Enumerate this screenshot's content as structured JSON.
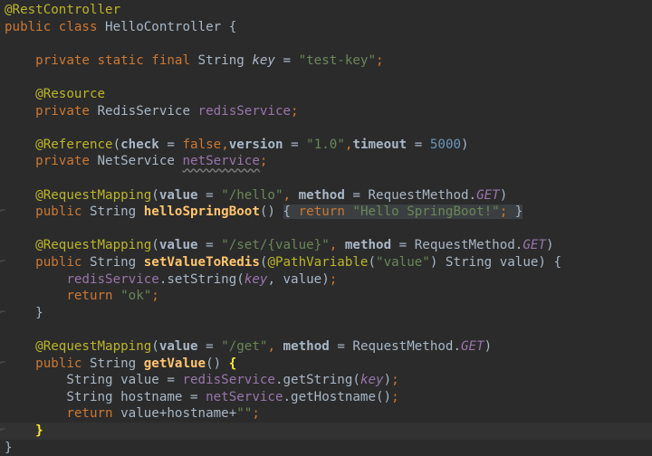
{
  "code_lines": [
    [
      {
        "t": "@RestController",
        "c": "an"
      }
    ],
    [
      {
        "t": "public ",
        "c": "kwp"
      },
      {
        "t": "class ",
        "c": "kwp"
      },
      {
        "t": "HelloController {",
        "c": "pl"
      }
    ],
    [],
    [
      {
        "t": "    private ",
        "c": "kwp"
      },
      {
        "t": "static ",
        "c": "kwp"
      },
      {
        "t": "final ",
        "c": "kwp"
      },
      {
        "t": "String ",
        "c": "pl"
      },
      {
        "t": "key",
        "c": "pl italic"
      },
      {
        "t": " = ",
        "c": "pl"
      },
      {
        "t": "\"test-key\"",
        "c": "str"
      },
      {
        "t": ";",
        "c": "kwp"
      }
    ],
    [],
    [
      {
        "t": "    @Resource",
        "c": "an"
      }
    ],
    [
      {
        "t": "    private ",
        "c": "kwp"
      },
      {
        "t": "RedisService ",
        "c": "pl"
      },
      {
        "t": "redisService",
        "c": "fld"
      },
      {
        "t": ";",
        "c": "kwp"
      }
    ],
    [],
    [
      {
        "t": "    @Reference",
        "c": "an"
      },
      {
        "t": "(",
        "c": "pl"
      },
      {
        "t": "check",
        "c": "pl bold"
      },
      {
        "t": " = ",
        "c": "pl"
      },
      {
        "t": "false",
        "c": "kwp"
      },
      {
        "t": ",",
        "c": "kwp"
      },
      {
        "t": "version",
        "c": "pl bold"
      },
      {
        "t": " = ",
        "c": "pl"
      },
      {
        "t": "\"1.0\"",
        "c": "str"
      },
      {
        "t": ",",
        "c": "kwp"
      },
      {
        "t": "timeout",
        "c": "pl bold"
      },
      {
        "t": " = ",
        "c": "pl"
      },
      {
        "t": "5000",
        "c": "num"
      },
      {
        "t": ")",
        "c": "pl"
      }
    ],
    [
      {
        "t": "    private ",
        "c": "kwp"
      },
      {
        "t": "NetService ",
        "c": "pl"
      },
      {
        "t": "netService",
        "c": "fld warn"
      },
      {
        "t": ";",
        "c": "kwp"
      }
    ],
    [],
    [
      {
        "t": "    @RequestMapping",
        "c": "an"
      },
      {
        "t": "(",
        "c": "pl"
      },
      {
        "t": "value",
        "c": "pl bold"
      },
      {
        "t": " = ",
        "c": "pl"
      },
      {
        "t": "\"/hello\"",
        "c": "str"
      },
      {
        "t": ", ",
        "c": "kwp"
      },
      {
        "t": "method",
        "c": "pl bold"
      },
      {
        "t": " = RequestMethod.",
        "c": "pl"
      },
      {
        "t": "GET",
        "c": "fld italic"
      },
      {
        "t": ")",
        "c": "pl"
      }
    ],
    [
      {
        "t": "    public ",
        "c": "kwp"
      },
      {
        "t": "String ",
        "c": "pl"
      },
      {
        "t": "helloSpringBoot",
        "c": "fn"
      },
      {
        "t": "() ",
        "c": "pl"
      },
      {
        "t": "{ ",
        "c": "pl folded"
      },
      {
        "t": "return ",
        "c": "kwp folded"
      },
      {
        "t": "\"Hello SpringBoot!\"",
        "c": "str folded"
      },
      {
        "t": "; ",
        "c": "kwp folded"
      },
      {
        "t": "}",
        "c": "pl folded"
      }
    ],
    [],
    [
      {
        "t": "    @RequestMapping",
        "c": "an"
      },
      {
        "t": "(",
        "c": "pl"
      },
      {
        "t": "value",
        "c": "pl bold"
      },
      {
        "t": " = ",
        "c": "pl"
      },
      {
        "t": "\"/set/{value}\"",
        "c": "str"
      },
      {
        "t": ", ",
        "c": "kwp"
      },
      {
        "t": "method",
        "c": "pl bold"
      },
      {
        "t": " = RequestMethod.",
        "c": "pl"
      },
      {
        "t": "GET",
        "c": "fld italic"
      },
      {
        "t": ")",
        "c": "pl"
      }
    ],
    [
      {
        "t": "    public ",
        "c": "kwp"
      },
      {
        "t": "String ",
        "c": "pl"
      },
      {
        "t": "setValueToRedis",
        "c": "fn"
      },
      {
        "t": "(",
        "c": "pl"
      },
      {
        "t": "@PathVariable",
        "c": "an"
      },
      {
        "t": "(",
        "c": "pl"
      },
      {
        "t": "\"value\"",
        "c": "str"
      },
      {
        "t": ") String value) {",
        "c": "pl"
      }
    ],
    [
      {
        "t": "        redisService",
        "c": "fld"
      },
      {
        "t": ".setString(",
        "c": "pl"
      },
      {
        "t": "key",
        "c": "fld italic"
      },
      {
        "t": ", value)",
        "c": "pl"
      },
      {
        "t": ";",
        "c": "kwp"
      }
    ],
    [
      {
        "t": "        return ",
        "c": "kwp"
      },
      {
        "t": "\"ok\"",
        "c": "str"
      },
      {
        "t": ";",
        "c": "kwp"
      }
    ],
    [
      {
        "t": "    }",
        "c": "pl"
      }
    ],
    [],
    [
      {
        "t": "    @RequestMapping",
        "c": "an"
      },
      {
        "t": "(",
        "c": "pl"
      },
      {
        "t": "value",
        "c": "pl bold"
      },
      {
        "t": " = ",
        "c": "pl"
      },
      {
        "t": "\"/get\"",
        "c": "str"
      },
      {
        "t": ", ",
        "c": "kwp"
      },
      {
        "t": "method",
        "c": "pl bold"
      },
      {
        "t": " = RequestMethod.",
        "c": "pl"
      },
      {
        "t": "GET",
        "c": "fld italic"
      },
      {
        "t": ")",
        "c": "pl"
      }
    ],
    [
      {
        "t": "    public ",
        "c": "kwp"
      },
      {
        "t": "String ",
        "c": "pl"
      },
      {
        "t": "getValue",
        "c": "fn"
      },
      {
        "t": "() ",
        "c": "pl"
      },
      {
        "t": "{",
        "c": "brace-hl"
      }
    ],
    [
      {
        "t": "        String value = ",
        "c": "pl"
      },
      {
        "t": "redisService",
        "c": "fld"
      },
      {
        "t": ".getString(",
        "c": "pl"
      },
      {
        "t": "key",
        "c": "fld italic"
      },
      {
        "t": ")",
        "c": "pl"
      },
      {
        "t": ";",
        "c": "kwp"
      }
    ],
    [
      {
        "t": "        String hostname = ",
        "c": "pl"
      },
      {
        "t": "netService",
        "c": "fld"
      },
      {
        "t": ".getHostname()",
        "c": "pl"
      },
      {
        "t": ";",
        "c": "kwp"
      }
    ],
    [
      {
        "t": "        return ",
        "c": "kwp"
      },
      {
        "t": "value+hostname+",
        "c": "pl"
      },
      {
        "t": "\"\"",
        "c": "str"
      },
      {
        "t": ";",
        "c": "kwp"
      }
    ],
    [
      {
        "t": "    ",
        "c": "pl"
      },
      {
        "t": "}",
        "c": "brace-hl"
      }
    ],
    [
      {
        "t": "}",
        "c": "pl"
      }
    ]
  ],
  "current_line": 25,
  "gutter_marks": [
    12,
    15,
    18,
    21,
    25
  ]
}
